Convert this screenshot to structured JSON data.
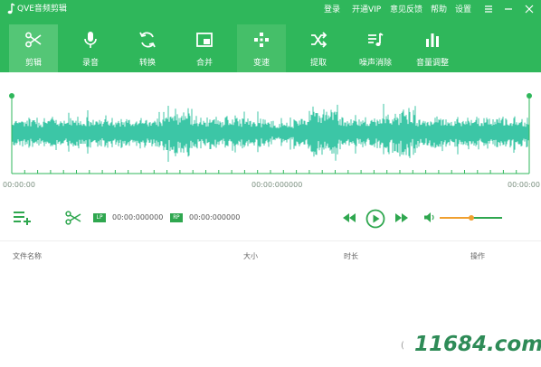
{
  "app": {
    "title": "QVE音频剪辑"
  },
  "topmenu": {
    "login": "登录",
    "vip": "开通VIP",
    "feedback": "意见反馈",
    "help": "帮助",
    "settings": "设置"
  },
  "toolbar": {
    "items": [
      {
        "label": "剪辑",
        "icon": "scissors-icon"
      },
      {
        "label": "录音",
        "icon": "microphone-icon"
      },
      {
        "label": "转换",
        "icon": "convert-icon"
      },
      {
        "label": "合并",
        "icon": "merge-icon"
      },
      {
        "label": "变速",
        "icon": "speed-icon"
      },
      {
        "label": "提取",
        "icon": "extract-icon"
      },
      {
        "label": "噪声消除",
        "icon": "noise-removal-icon"
      },
      {
        "label": "音量调整",
        "icon": "volume-adjust-icon"
      }
    ]
  },
  "waveform": {
    "time_start": "00:00:00",
    "time_mid": "00:00:000000",
    "time_end": "00:00:00"
  },
  "controls": {
    "lp_tag": "LP",
    "lp_time": "00:00:000000",
    "rp_tag": "RP",
    "rp_time": "00:00:000000",
    "volume_level": 0.5
  },
  "table": {
    "col_name": "文件名称",
    "col_size": "大小",
    "col_duration": "时长",
    "col_action": "操作"
  },
  "watermark": {
    "text": "11684.com"
  },
  "colors": {
    "brand_green": "#2fb75b",
    "wave": "#3cc6a6",
    "accent_orange": "#f0a030",
    "ctrl_green": "#2fa74f"
  }
}
